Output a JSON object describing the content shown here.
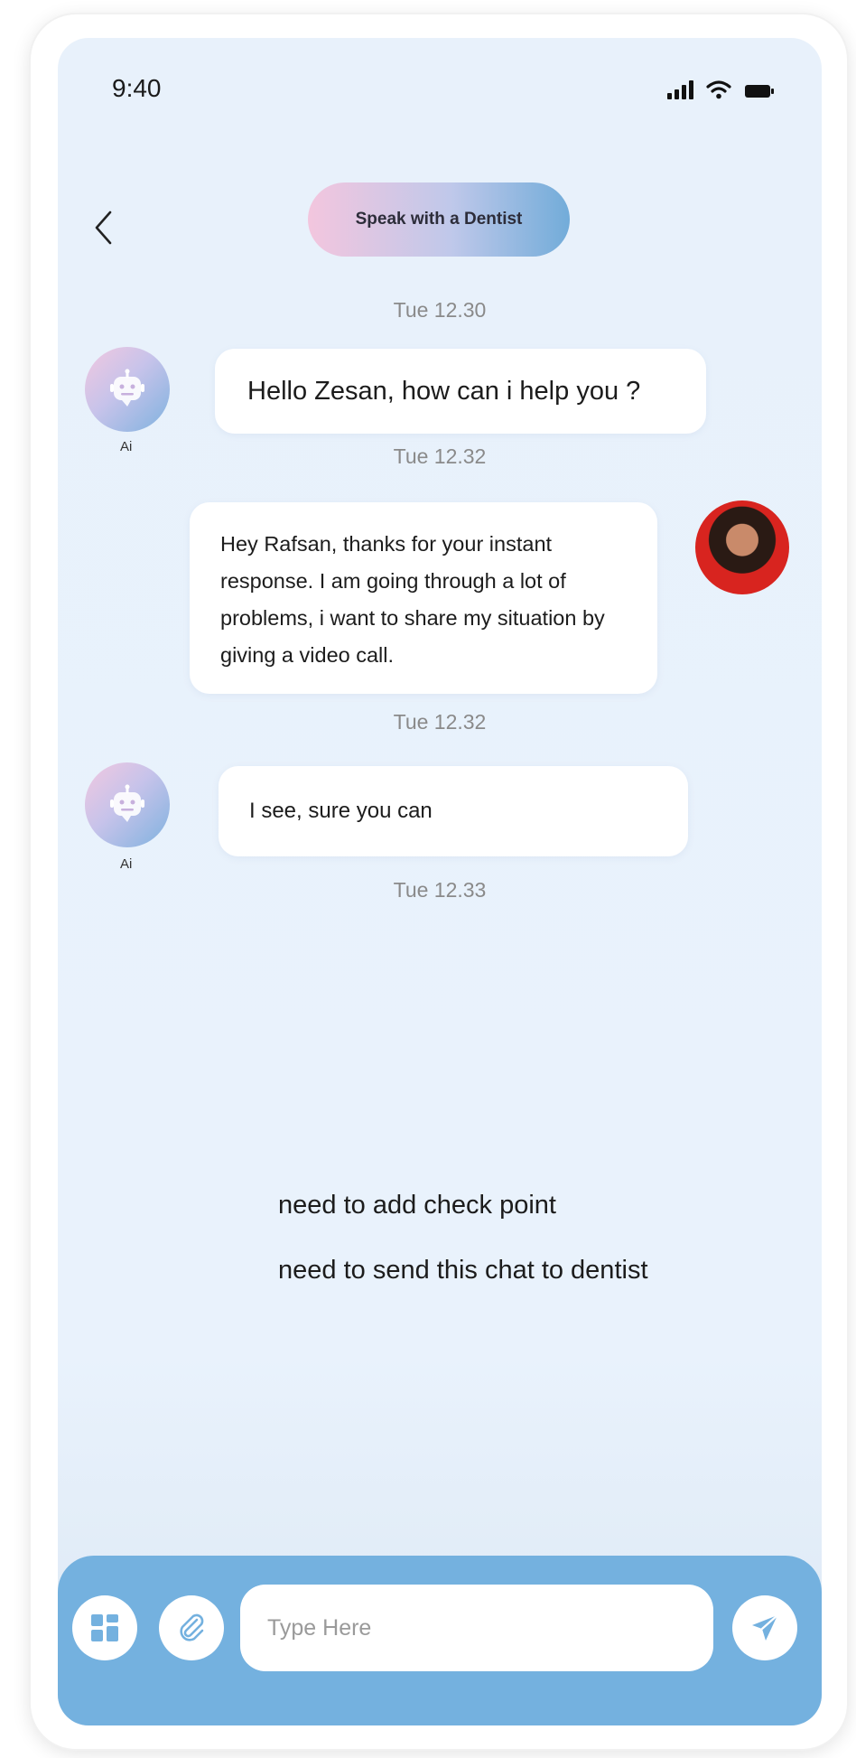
{
  "status_bar": {
    "time": "9:40"
  },
  "header": {
    "title": "Speak with a Dentist"
  },
  "messages": [
    {
      "timestamp": "Tue 12.30",
      "sender": "ai",
      "text": "Hello Zesan, how can i help you ?",
      "avatar_label": "Ai"
    },
    {
      "timestamp": "Tue 12.32",
      "sender": "user",
      "text": "Hey Rafsan, thanks for your instant response. I am going through a lot of problems, i want to share my situation by giving a video call."
    },
    {
      "timestamp": "Tue 12.32",
      "sender": "ai",
      "text": "I see, sure you can",
      "avatar_label": "Ai"
    },
    {
      "timestamp": "Tue 12.33"
    }
  ],
  "notes": [
    "need to add check point",
    "need to send this chat to dentist"
  ],
  "composer": {
    "placeholder": "Type Here"
  },
  "colors": {
    "accent": "#74b1df",
    "background": "#e8f1fb",
    "bubble": "#ffffff"
  },
  "icons": [
    "back-chevron-icon",
    "signal-icon",
    "wifi-icon",
    "battery-icon",
    "robot-icon",
    "grid-icon",
    "paperclip-icon",
    "send-icon"
  ]
}
